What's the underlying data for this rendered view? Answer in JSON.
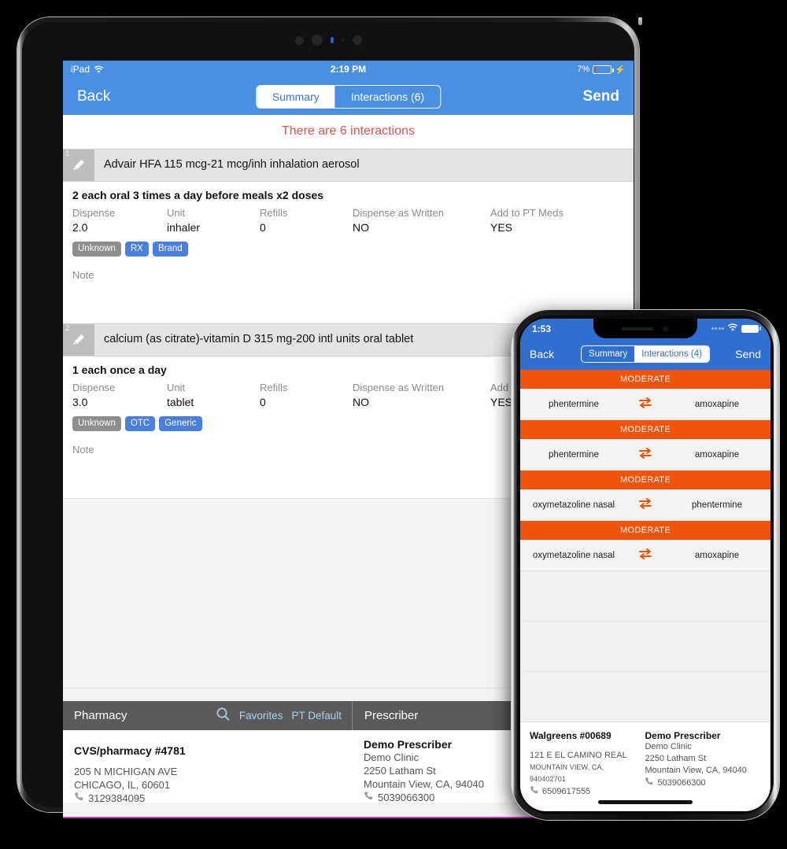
{
  "ipad": {
    "status": {
      "device": "iPad",
      "time": "2:19 PM",
      "battery": "7%"
    },
    "nav": {
      "back": "Back",
      "send": "Send",
      "tabs": [
        {
          "label": "Summary",
          "active": true
        },
        {
          "label": "Interactions (6)",
          "active": false
        }
      ]
    },
    "banner": "There are 6 interactions",
    "meds": [
      {
        "num": "1",
        "title": "Advair HFA 115 mcg-21 mcg/inh inhalation aerosol",
        "sig": "2 each oral 3 times a day before meals x2 doses",
        "labels": [
          "Dispense",
          "Unit",
          "Refills",
          "Dispense as Written",
          "Add to PT Meds"
        ],
        "values": [
          "2.0",
          "inhaler",
          "0",
          "NO",
          "YES"
        ],
        "tags": [
          {
            "text": "Unknown",
            "style": "gray"
          },
          {
            "text": "RX",
            "style": "blue"
          },
          {
            "text": "Brand",
            "style": "blue"
          }
        ],
        "note": "Note"
      },
      {
        "num": "2",
        "title": "calcium (as citrate)-vitamin D 315 mg-200 intl units oral tablet",
        "sig": "1 each once a day",
        "labels": [
          "Dispense",
          "Unit",
          "Refills",
          "Dispense as Written",
          "Add to PT Meds"
        ],
        "values": [
          "3.0",
          "tablet",
          "0",
          "NO",
          "YES"
        ],
        "tags": [
          {
            "text": "Unknown",
            "style": "gray"
          },
          {
            "text": "OTC",
            "style": "blue"
          },
          {
            "text": "Generic",
            "style": "blue"
          }
        ],
        "note": "Note"
      }
    ],
    "footer": {
      "pharmacy_title": "Pharmacy",
      "favorites": "Favorites",
      "pt_default": "PT Default",
      "prescriber_title": "Prescriber",
      "pharmacy": {
        "name": "CVS/pharmacy #4781",
        "address1": "205 N MICHIGAN AVE",
        "address2": "CHICAGO, IL, 60601",
        "phone": "3129384095"
      },
      "prescriber": {
        "name": "Demo Prescriber",
        "clinic": "Demo Clinic",
        "address1": "2250 Latham St",
        "address2": "Mountain View, CA, 94040",
        "phone": "5039066300"
      }
    }
  },
  "iphone": {
    "status": {
      "time": "1:53"
    },
    "nav": {
      "back": "Back",
      "send": "Send",
      "tabs": [
        {
          "label": "Summary",
          "active": false
        },
        {
          "label": "Interactions (4)",
          "active": true
        }
      ]
    },
    "interactions": [
      {
        "severity": "MODERATE",
        "drug_a": "phentermine",
        "drug_b": "amoxapine"
      },
      {
        "severity": "MODERATE",
        "drug_a": "phentermine",
        "drug_b": "amoxapine"
      },
      {
        "severity": "MODERATE",
        "drug_a": "oxymetazoline nasal",
        "drug_b": "phentermine"
      },
      {
        "severity": "MODERATE",
        "drug_a": "oxymetazoline nasal",
        "drug_b": "amoxapine"
      }
    ],
    "footer": {
      "pharmacy": {
        "name": "Walgreens #00689",
        "address1": "121 E EL CAMINO REAL",
        "address2": "MOUNTAIN VIEW, CA, 940402701",
        "phone": "6509617555"
      },
      "prescriber": {
        "name": "Demo Prescriber",
        "clinic": "Demo Clinic",
        "address1": "2250 Latham St",
        "address2": "Mountain View, CA, 94040",
        "phone": "5039066300"
      }
    }
  },
  "colors": {
    "ipad_blue": "#4a90e2",
    "iphone_blue": "#2f6fd0",
    "severity_orange": "#f0540c",
    "banner_red": "#d9534f",
    "tag_blue": "#4a7fe0",
    "tag_gray": "#8e8e8e"
  }
}
